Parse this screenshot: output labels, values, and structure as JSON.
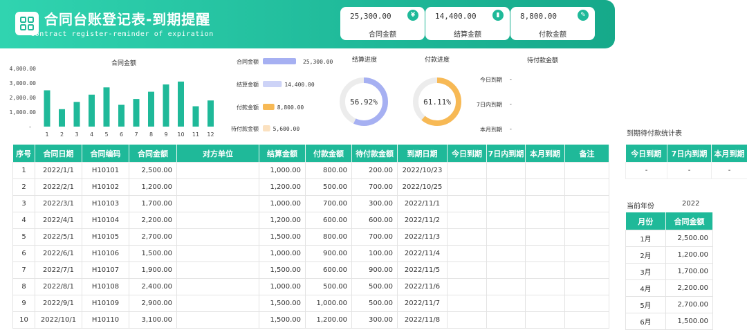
{
  "header": {
    "title": "合同台账登记表-到期提醒",
    "subtitle": "contract register-reminder of expiration"
  },
  "kpis": [
    {
      "value": "25,300.00",
      "label": "合同金额",
      "icon": "yen-icon",
      "glyph": "¥"
    },
    {
      "value": "14,400.00",
      "label": "结算金额",
      "icon": "bar-chart-icon",
      "glyph": "▮"
    },
    {
      "value": "8,800.00",
      "label": "付款金额",
      "icon": "edit-icon",
      "glyph": "✎"
    }
  ],
  "chart_data": [
    {
      "type": "bar",
      "title": "合同金额",
      "categories": [
        "1",
        "2",
        "3",
        "4",
        "5",
        "6",
        "7",
        "8",
        "9",
        "10",
        "11",
        "12"
      ],
      "values": [
        2500,
        1200,
        1700,
        2200,
        2700,
        1500,
        1900,
        2400,
        2900,
        3100,
        1400,
        1800
      ],
      "yticks": [
        "4,000.00",
        "3,000.00",
        "2,000.00",
        "1,000.00",
        "-"
      ],
      "ylim": [
        0,
        4000
      ],
      "color": "#1fb999"
    },
    {
      "type": "bar",
      "orientation": "horizontal",
      "categories": [
        "合同金额",
        "结算金额",
        "付款金额",
        "待付款金额"
      ],
      "values": [
        25300,
        14400,
        8800,
        5600
      ],
      "labels": [
        "25,300.00",
        "14,400.00",
        "8,800.00",
        "5,600.00"
      ],
      "colors": [
        "#a6b0f2",
        "#cdd3f7",
        "#f7b955",
        "#fbe1c0"
      ],
      "xlim": [
        0,
        25300
      ]
    },
    {
      "type": "pie",
      "title": "结算进度",
      "value": 0.5692,
      "label": "56.92%",
      "color": "#a6b0f2"
    },
    {
      "type": "pie",
      "title": "付款进度",
      "value": 0.6111,
      "label": "61.11%",
      "color": "#f7b955"
    }
  ],
  "pending": {
    "title": "待付款金额",
    "rows": [
      {
        "label": "今日到期",
        "value": "-"
      },
      {
        "label": "7日内到期",
        "value": "-"
      },
      {
        "label": "本月到期",
        "value": "-"
      }
    ]
  },
  "main_table": {
    "headers": [
      "序号",
      "合同日期",
      "合同编码",
      "合同金额",
      "对方单位",
      "结算金额",
      "付款金额",
      "待付款金额",
      "到期日期",
      "今日到期",
      "7日内到期",
      "本月到期",
      "备注"
    ],
    "rows": [
      [
        "1",
        "2022/1/1",
        "H10101",
        "2,500.00",
        "",
        "1,000.00",
        "800.00",
        "200.00",
        "2022/10/23",
        "",
        "",
        "",
        ""
      ],
      [
        "2",
        "2022/2/1",
        "H10102",
        "1,200.00",
        "",
        "1,200.00",
        "500.00",
        "700.00",
        "2022/10/25",
        "",
        "",
        "",
        ""
      ],
      [
        "3",
        "2022/3/1",
        "H10103",
        "1,700.00",
        "",
        "1,000.00",
        "700.00",
        "300.00",
        "2022/11/1",
        "",
        "",
        "",
        ""
      ],
      [
        "4",
        "2022/4/1",
        "H10104",
        "2,200.00",
        "",
        "1,200.00",
        "600.00",
        "600.00",
        "2022/11/2",
        "",
        "",
        "",
        ""
      ],
      [
        "5",
        "2022/5/1",
        "H10105",
        "2,700.00",
        "",
        "1,500.00",
        "800.00",
        "700.00",
        "2022/11/3",
        "",
        "",
        "",
        ""
      ],
      [
        "6",
        "2022/6/1",
        "H10106",
        "1,500.00",
        "",
        "1,000.00",
        "900.00",
        "100.00",
        "2022/11/4",
        "",
        "",
        "",
        ""
      ],
      [
        "7",
        "2022/7/1",
        "H10107",
        "1,900.00",
        "",
        "1,500.00",
        "600.00",
        "900.00",
        "2022/11/5",
        "",
        "",
        "",
        ""
      ],
      [
        "8",
        "2022/8/1",
        "H10108",
        "2,400.00",
        "",
        "1,000.00",
        "500.00",
        "500.00",
        "2022/11/6",
        "",
        "",
        "",
        ""
      ],
      [
        "9",
        "2022/9/1",
        "H10109",
        "2,900.00",
        "",
        "1,500.00",
        "1,000.00",
        "500.00",
        "2022/11/7",
        "",
        "",
        "",
        ""
      ],
      [
        "10",
        "2022/10/1",
        "H10110",
        "3,100.00",
        "",
        "1,500.00",
        "1,200.00",
        "300.00",
        "2022/11/8",
        "",
        "",
        "",
        ""
      ]
    ]
  },
  "side_stats": {
    "title": "到期待付款统计表",
    "headers": [
      "今日到期",
      "7日内到期",
      "本月到期"
    ],
    "values": [
      "-",
      "-",
      "-"
    ]
  },
  "year_table": {
    "label": "当前年份",
    "year": "2022",
    "headers": [
      "月份",
      "合同金额"
    ],
    "rows": [
      [
        "1月",
        "2,500.00"
      ],
      [
        "2月",
        "1,200.00"
      ],
      [
        "3月",
        "1,700.00"
      ],
      [
        "4月",
        "2,200.00"
      ],
      [
        "5月",
        "2,700.00"
      ],
      [
        "6月",
        "1,500.00"
      ]
    ]
  }
}
